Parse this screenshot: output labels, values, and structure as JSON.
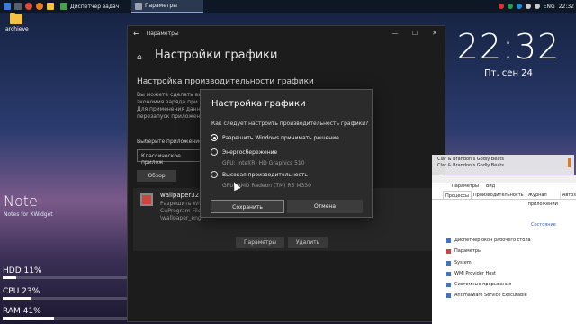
{
  "taskbar": {
    "tasks": [
      {
        "label": "Диспетчер задач",
        "active": false
      },
      {
        "label": "Параметры",
        "active": true
      }
    ],
    "tray": {
      "lang": "ENG",
      "time": "22:32"
    }
  },
  "desktop": {
    "icon_label": "archieve",
    "note_title": "Note",
    "note_subtitle": "Notes for XWidget",
    "stats": [
      {
        "label": "HDD 11%",
        "value": 11
      },
      {
        "label": "CPU 23%",
        "value": 23
      },
      {
        "label": "RAM 41%",
        "value": 41
      }
    ]
  },
  "settings": {
    "title": "Параметры",
    "heading": "Настройки графики",
    "section": "Настройка производительности графики",
    "desc_lines": [
      "Вы можете сделать вы",
      "экономия заряда при и",
      "Для применения данно",
      "перезапуск приложени"
    ],
    "choose_label": "Выберите приложение",
    "select_value": "Классическое прилож",
    "browse_button": "Обзор",
    "app": {
      "name": "wallpaper32.exe",
      "lines": [
        "Разрешить Windo",
        "C:\\Program Files",
        "\\wallpaper_engi"
      ],
      "params_button": "Параметры",
      "remove_button": "Удалить"
    }
  },
  "dialog": {
    "title": "Настройка графики",
    "question": "Как следует настроить производительность графики?",
    "options": [
      {
        "label": "Разрешить Windows принимать решение",
        "selected": true,
        "gpu": ""
      },
      {
        "label": "Энергосбережение",
        "selected": false,
        "gpu": "GPU: Intel(R) HD Graphics 510"
      },
      {
        "label": "Высокая производительность",
        "selected": false,
        "gpu": "GPU: AMD Radeon (TM) R5 M330"
      }
    ],
    "save_button": "Сохранить",
    "cancel_button": "Отмена"
  },
  "clock": {
    "time": "22:32",
    "date": "Пт, сен 24"
  },
  "music": {
    "line1": "Clar & Brandon's Godly Beats",
    "line2": "Clar & Brandon's Godly Beats"
  },
  "task_manager": {
    "menu": [
      "Параметры",
      "Вид"
    ],
    "tabs": [
      "Процессы",
      "Производительность",
      "Журнал приложений",
      "Автоз"
    ],
    "column": "Состояние",
    "rows": [
      "Диспетчер окон рабочего стола",
      "Параметры",
      "System",
      "WMI Provider Host",
      "Системные прерывания",
      "Antimalware Service Executable"
    ]
  }
}
